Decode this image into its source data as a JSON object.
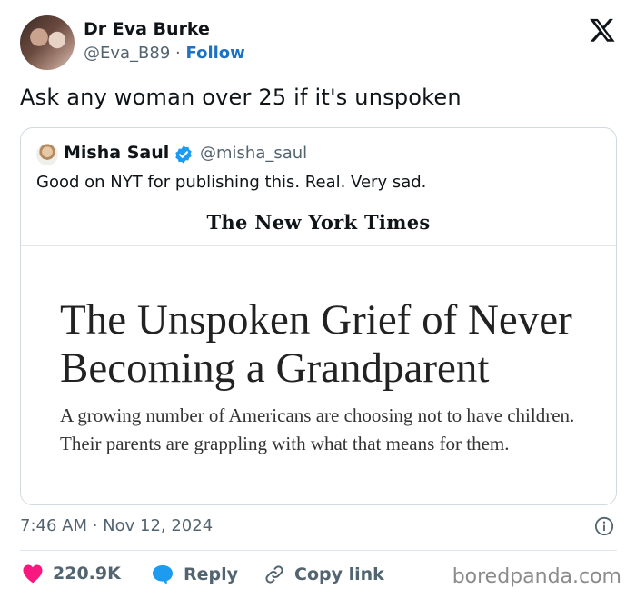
{
  "author": {
    "name": "Dr Eva Burke",
    "handle": "@Eva_B89",
    "separator": "·",
    "follow_label": "Follow"
  },
  "tweet": {
    "text": "Ask any woman over 25 if it's unspoken"
  },
  "quoted": {
    "name": "Misha Saul",
    "handle": "@misha_saul",
    "text": "Good on NYT for publishing this. Real. Very sad.",
    "article": {
      "publication": "The New York Times",
      "headline": "The Unspoken Grief of Never Becoming a Grandparent",
      "dek": "A growing number of Americans are choosing not to have children. Their parents are grappling with what that means for them."
    }
  },
  "meta": {
    "timestamp": "7:46 AM · Nov 12, 2024"
  },
  "actions": {
    "likes": "220.9K",
    "reply_label": "Reply",
    "copy_label": "Copy link"
  },
  "icons": {
    "platform": "x-logo-icon",
    "verified": "verified-badge-icon",
    "info": "info-icon",
    "like": "heart-icon",
    "reply": "speech-bubble-icon",
    "copy": "link-icon"
  },
  "colors": {
    "follow": "#1d72c4",
    "verified": "#1d9bf0",
    "like": "#f91880",
    "reply": "#1d9bf0",
    "muted": "#536471"
  },
  "watermark": "boredpanda.com"
}
